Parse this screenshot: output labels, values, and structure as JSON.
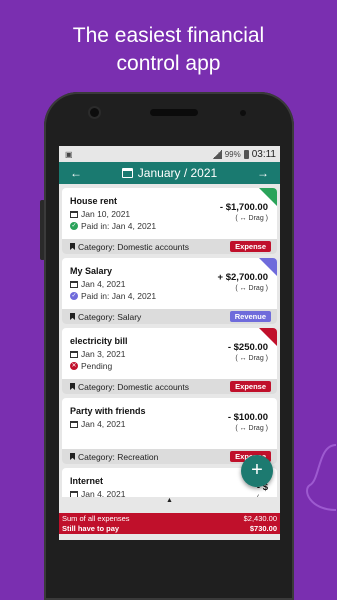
{
  "headline": {
    "line1": "The easiest financial",
    "line2": "control app"
  },
  "status_bar": {
    "battery": "99%",
    "time": "03:11"
  },
  "app_bar": {
    "prev": "←",
    "title": "January / 2021",
    "next": "→"
  },
  "entries": [
    {
      "name": "House rent",
      "date": "Jan 10, 2021",
      "status": "Paid in: Jan 4, 2021",
      "status_type": "paid",
      "amount": "- $1,700.00",
      "drag": "( ↔ Drag )",
      "category": "Category: Domestic accounts",
      "badge": "Expense",
      "badge_color": "#c0102b",
      "corner_color": "#2aa35a"
    },
    {
      "name": "My Salary",
      "date": "Jan 4, 2021",
      "status": "Paid in: Jan 4, 2021",
      "status_type": "received",
      "amount": "+ $2,700.00",
      "drag": "( ↔ Drag )",
      "category": "Category: Salary",
      "badge": "Revenue",
      "badge_color": "#6f6bdb",
      "corner_color": "#6f6bdb"
    },
    {
      "name": "electricity bill",
      "date": "Jan 3, 2021",
      "status": "Pending",
      "status_type": "pending",
      "amount": "- $250.00",
      "drag": "( ↔ Drag )",
      "category": "Category: Domestic accounts",
      "badge": "Expense",
      "badge_color": "#c0102b",
      "corner_color": "#c0102b"
    },
    {
      "name": "Party with friends",
      "date": "Jan 4, 2021",
      "status": "",
      "status_type": "none",
      "amount": "- $100.00",
      "drag": "( ↔ Drag )",
      "category": "Category: Recreation",
      "badge": "Expense",
      "badge_color": "#c0102b",
      "corner_color": ""
    },
    {
      "name": "Internet",
      "date": "Jan 4, 2021",
      "status": "",
      "status_type": "none",
      "amount": "- $",
      "drag": "( ↔",
      "category": "",
      "badge": "",
      "badge_color": "",
      "corner_color": ""
    }
  ],
  "scroll_indicator": "▲",
  "summary": {
    "expenses_label": "Sum of all expenses",
    "expenses_value": "$2,430.00",
    "to_pay_label": "Still have to pay",
    "to_pay_value": "$730.00"
  },
  "fab": {
    "label": "+"
  },
  "colors": {
    "background": "#7a2fb0",
    "app_bar": "#1a7a70",
    "expense": "#c0102b",
    "revenue": "#6f6bdb",
    "paid": "#2aa35a"
  }
}
